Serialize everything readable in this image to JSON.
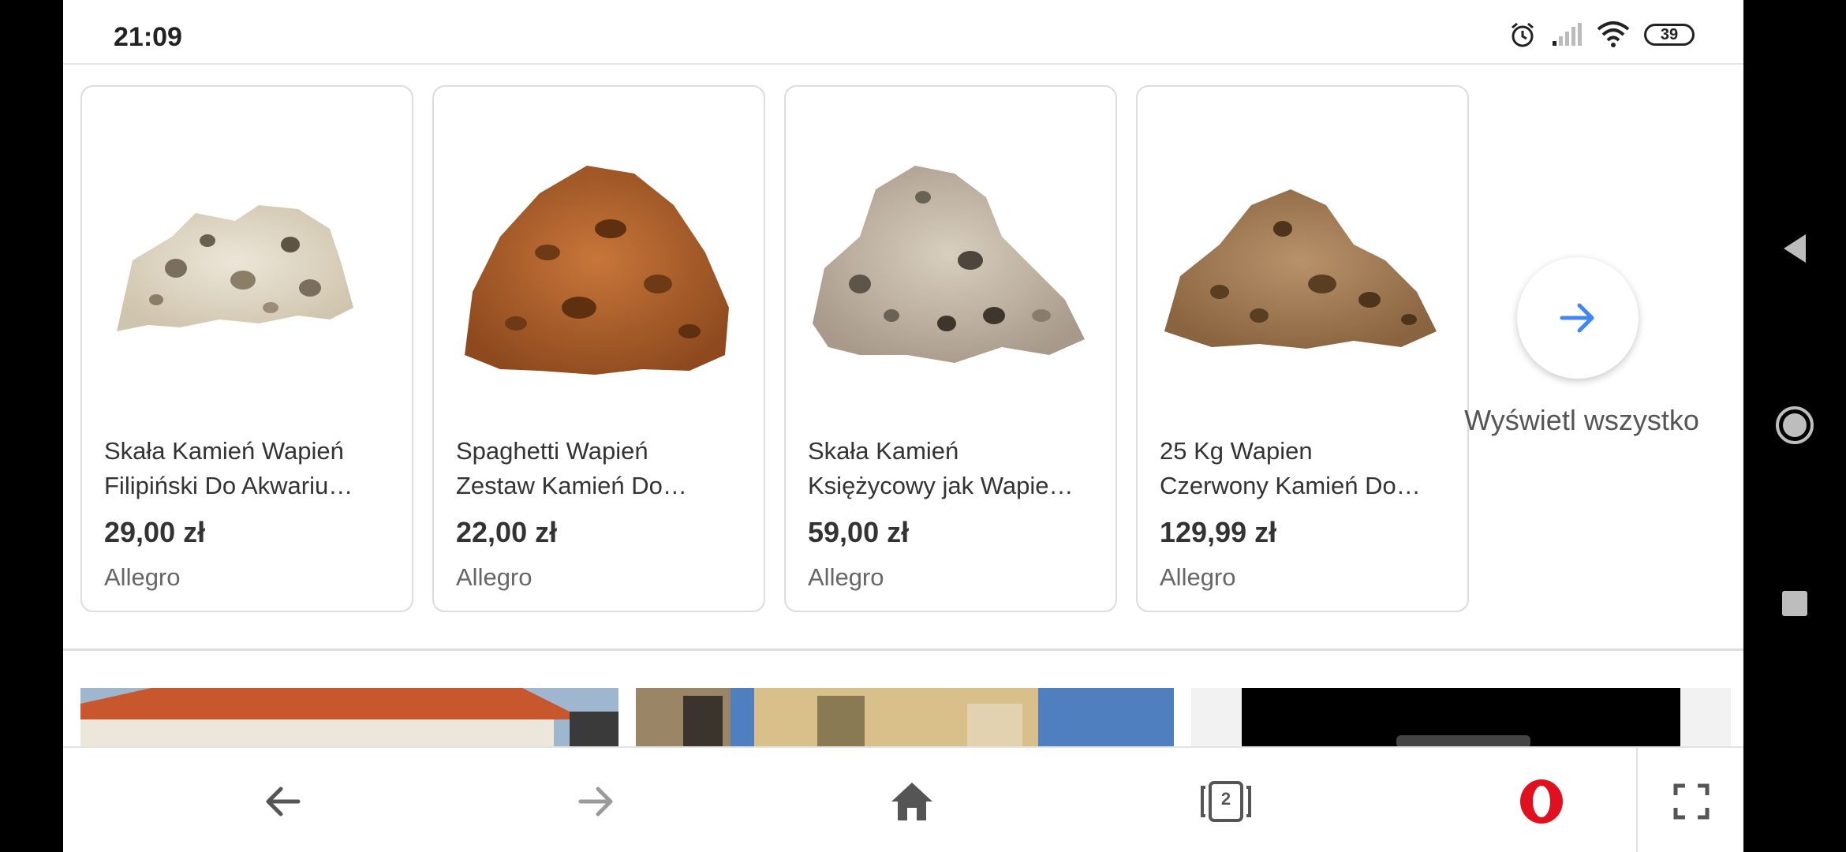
{
  "status": {
    "time": "21:09",
    "battery": "39"
  },
  "products": [
    {
      "title_line1": "Skała Kamień Wapień",
      "title_line2": "Filipiński Do Akwariu…",
      "price": "29,00 zł",
      "store": "Allegro"
    },
    {
      "title_line1": "Spaghetti Wapień",
      "title_line2": "Zestaw Kamień Do…",
      "price": "22,00 zł",
      "store": "Allegro"
    },
    {
      "title_line1": "Skała Kamień",
      "title_line2": "Księżycowy jak Wapie…",
      "price": "59,00 zł",
      "store": "Allegro"
    },
    {
      "title_line1": "25 Kg Wapien",
      "title_line2": "Czerwony Kamień Do…",
      "price": "129,99 zł",
      "store": "Allegro"
    }
  ],
  "view_all": {
    "label": "Wyświetl wszystko"
  },
  "toolbar": {
    "tabs_count": "2",
    "icons": [
      "back-arrow-icon",
      "forward-arrow-icon",
      "home-icon",
      "tabs-icon",
      "opera-menu-icon",
      "fullscreen-icon"
    ]
  },
  "colors": {
    "accent_blue": "#4285f4",
    "opera_red": "#e0101e"
  }
}
